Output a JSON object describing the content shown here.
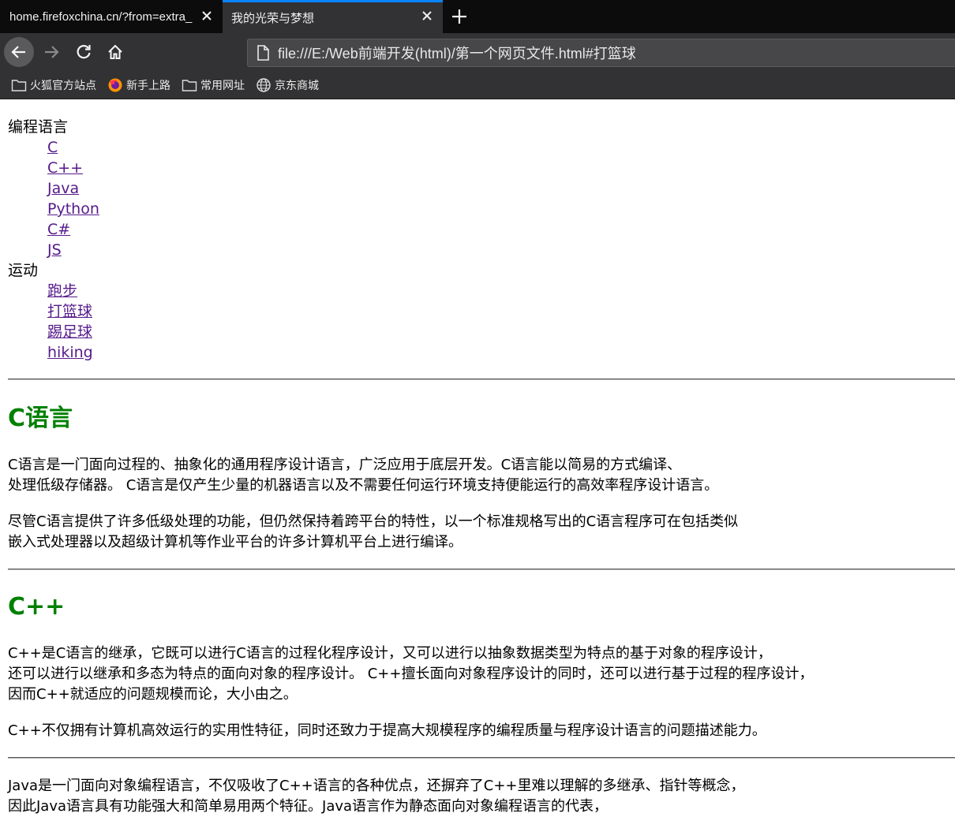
{
  "browser": {
    "tabs": [
      {
        "title": "home.firefoxchina.cn/?from=extra_start",
        "active": false
      },
      {
        "title": "我的光荣与梦想",
        "active": true
      }
    ],
    "url": "file:///E:/Web前端开发(html)/第一个网页文件.html#打篮球",
    "bookmarks": [
      {
        "label": "火狐官方站点",
        "icon": "folder-icon"
      },
      {
        "label": "新手上路",
        "icon": "firefox-icon"
      },
      {
        "label": "常用网址",
        "icon": "folder-icon"
      },
      {
        "label": "京东商城",
        "icon": "globe-icon"
      }
    ],
    "colors": {
      "accent": "#0a84ff",
      "chrome": "#323234",
      "tabbar": "#0c0c0d"
    }
  },
  "page": {
    "nav": {
      "programming_title": "编程语言",
      "programming_links": [
        "C",
        "C++",
        "Java",
        "Python",
        "C#",
        "JS"
      ],
      "sports_title": "运动",
      "sports_links": [
        "跑步",
        "打篮球",
        "踢足球",
        "hiking"
      ]
    },
    "sections": {
      "c": {
        "heading": "C语言",
        "p1_line1": "C语言是一门面向过程的、抽象化的通用程序设计语言，广泛应用于底层开发。C语言能以简易的方式编译、",
        "p1_line2": "处理低级存储器。 C语言是仅产生少量的机器语言以及不需要任何运行环境支持便能运行的高效率程序设计语言。",
        "p2_line1": "尽管C语言提供了许多低级处理的功能，但仍然保持着跨平台的特性，以一个标准规格写出的C语言程序可在包括类似",
        "p2_line2": "嵌入式处理器以及超级计算机等作业平台的许多计算机平台上进行编译。"
      },
      "cpp": {
        "heading": "C++",
        "p1_line1": "C++是C语言的继承，它既可以进行C语言的过程化程序设计，又可以进行以抽象数据类型为特点的基于对象的程序设计，",
        "p1_line2": "还可以进行以继承和多态为特点的面向对象的程序设计。 C++擅长面向对象程序设计的同时，还可以进行基于过程的程序设计，",
        "p1_line3": "因而C++就适应的问题规模而论，大小由之。",
        "p2_line1": "C++不仅拥有计算机高效运行的实用性特征，同时还致力于提高大规模程序的编程质量与程序设计语言的问题描述能力。"
      },
      "java": {
        "p1_line1": "Java是一门面向对象编程语言，不仅吸收了C++语言的各种优点，还摒弃了C++里难以理解的多继承、指针等概念，",
        "p1_line2": "因此Java语言具有功能强大和简单易用两个特征。Java语言作为静态面向对象编程语言的代表，"
      }
    },
    "colors": {
      "heading": "#008000",
      "visited_link": "#551a8b"
    }
  }
}
